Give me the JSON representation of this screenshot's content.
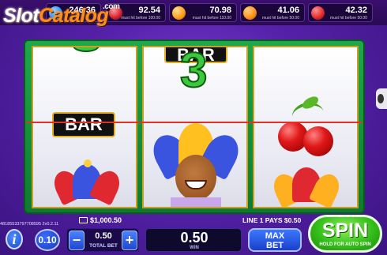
{
  "logo": {
    "slot": "Slot",
    "catalog": "Catalog",
    "com": ".com"
  },
  "jackpots": [
    {
      "value": "246.36",
      "note": "",
      "color": "#2a8cff"
    },
    {
      "value": "92.54",
      "note": "must hit before 100.00",
      "color": "#d02030"
    },
    {
      "value": "70.98",
      "note": "must hit before 110.00",
      "color": "#ff9a1a"
    },
    {
      "value": "41.06",
      "note": "must hit before 50.00",
      "color": "#ff8c1a"
    },
    {
      "value": "42.32",
      "note": "must hit before 50.00",
      "color": "#e0282c"
    }
  ],
  "reels": {
    "reel1": {
      "top": "",
      "middle": "BAR",
      "bottom": "jester"
    },
    "reel2": {
      "top": "BAR",
      "middle": "3",
      "bottom": "jester"
    },
    "reel3": {
      "top": "",
      "middle": "cherry",
      "bottom": "jester"
    }
  },
  "status": {
    "balance": "$1,000.50",
    "paylines": "LINE 1 PAYS $0.50",
    "version": "48185533797708595 2v0.2.11"
  },
  "controls": {
    "info_label": "i",
    "lines_value": "0.10",
    "minus_label": "−",
    "plus_label": "+",
    "total_bet_value": "0.50",
    "total_bet_label": "TOTAL BET",
    "win_value": "0.50",
    "win_label": "WIN",
    "max_bet_line1": "MAX",
    "max_bet_line2": "BET",
    "spin_label": "SPIN",
    "spin_sub": "HOLD FOR AUTO SPIN"
  },
  "colors": {
    "background": "#5521a8",
    "frame": "#1fa84a",
    "payline": "#e0302a",
    "spin": "#35c01a",
    "button_blue": "#1f46d0"
  }
}
